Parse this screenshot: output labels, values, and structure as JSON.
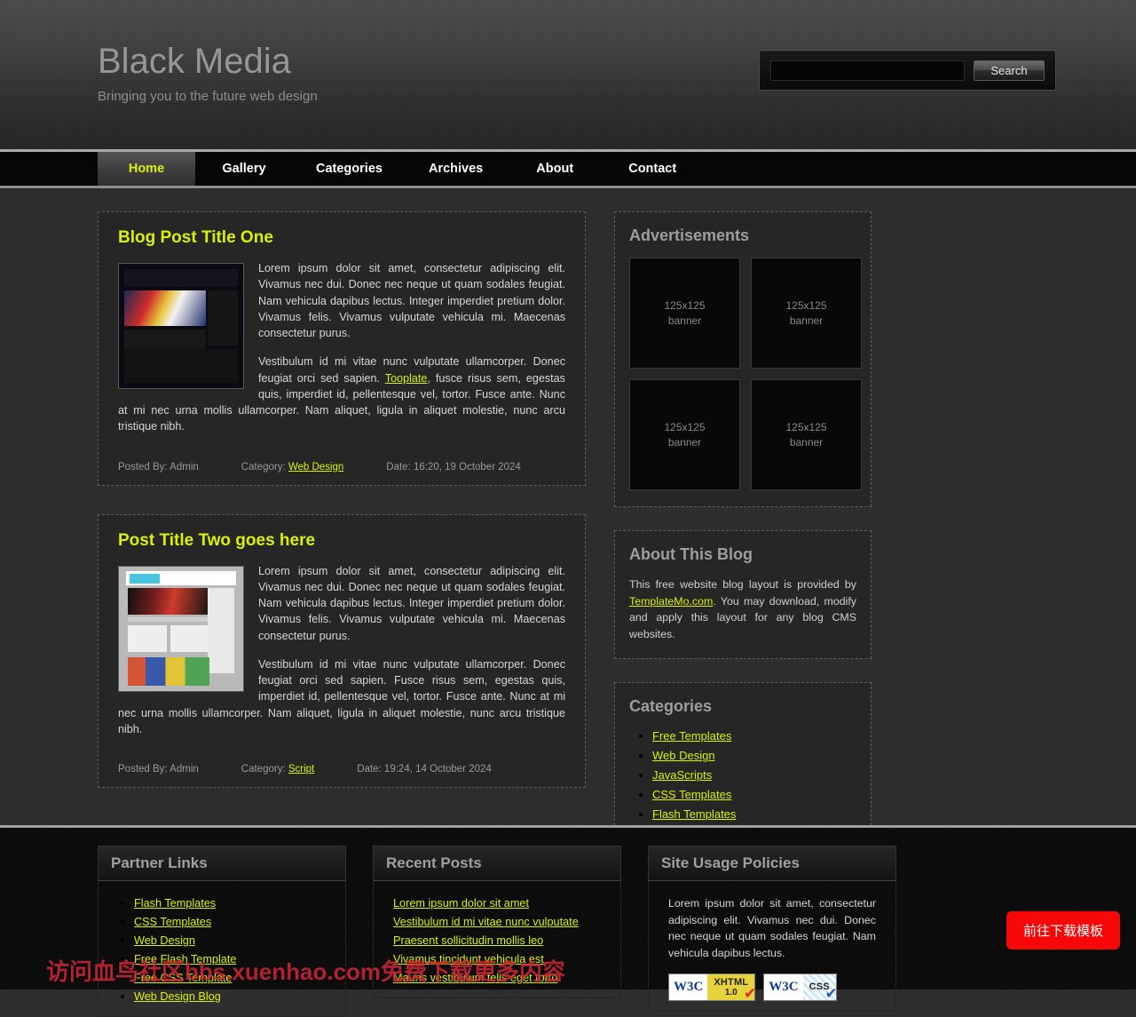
{
  "header": {
    "title": "Black Media",
    "tagline": "Bringing you to the future web design",
    "search": {
      "value": "",
      "placeholder": "",
      "button_label": "Search"
    }
  },
  "nav": {
    "items": [
      {
        "label": "Home",
        "active": true
      },
      {
        "label": "Gallery",
        "active": false
      },
      {
        "label": "Categories",
        "active": false
      },
      {
        "label": "Archives",
        "active": false
      },
      {
        "label": "About",
        "active": false
      },
      {
        "label": "Contact",
        "active": false
      }
    ]
  },
  "posts": [
    {
      "title": "Blog Post Title One",
      "para1": "Lorem ipsum dolor sit amet, consectetur adipiscing elit. Vivamus nec dui. Donec nec neque ut quam sodales feugiat. Nam vehicula dapibus lectus. Integer imperdiet pretium dolor. Vivamus felis. Vivamus vulputate vehicula mi. Maecenas consectetur purus.",
      "para2_before": "Vestibulum id mi vitae nunc vulputate ullamcorper. Donec feugiat orci sed sapien. ",
      "para2_link": "Tooplate",
      "para2_after": ", fusce risus sem, egestas quis, imperdiet id, pellentesque vel, tortor. Fusce ante. Nunc at mi nec urna mollis ullamcorper. Nam aliquet, ligula in aliquet molestie, nunc arcu tristique nibh.",
      "posted_by": "Posted By: Admin",
      "category_label": "Category:",
      "category_link": "Web Design",
      "date": "Date: 16:20, 19 October 2024"
    },
    {
      "title": "Post Title Two goes here",
      "para1": "Lorem ipsum dolor sit amet, consectetur adipiscing elit. Vivamus nec dui. Donec nec neque ut quam sodales feugiat. Nam vehicula dapibus lectus. Integer imperdiet pretium dolor. Vivamus felis. Vivamus vulputate vehicula mi. Maecenas consectetur purus.",
      "para2_before": "Vestibulum id mi vitae nunc vulputate ullamcorper. Donec feugiat orci sed sapien. Fusce risus sem, egestas quis, imperdiet id, pellentesque vel, tortor. Fusce ante. Nunc at mi nec urna mollis ullamcorper. Nam aliquet, ligula in aliquet molestie, nunc arcu tristique nibh.",
      "para2_link": "",
      "para2_after": "",
      "posted_by": "Posted By: Admin",
      "category_label": "Category:",
      "category_link": "Script",
      "date": "Date: 19:24, 14 October 2024"
    }
  ],
  "sidebar": {
    "ads": {
      "title": "Advertisements",
      "banners": [
        {
          "size": "125x125",
          "caption": "banner"
        },
        {
          "size": "125x125",
          "caption": "banner"
        },
        {
          "size": "125x125",
          "caption": "banner"
        },
        {
          "size": "125x125",
          "caption": "banner"
        }
      ]
    },
    "about": {
      "title": "About This Blog",
      "text_before": "This free website blog layout is provided by ",
      "link": "TemplateMo.com",
      "text_after": ". You may download, modify and apply this layout for any blog CMS websites."
    },
    "categories": {
      "title": "Categories",
      "items": [
        "Free Templates",
        "Web Design",
        "JavaScripts",
        "CSS Templates",
        "Flash Templates"
      ]
    }
  },
  "footer": {
    "partner_links": {
      "title": "Partner Links",
      "items": [
        "Flash Templates",
        "CSS Templates",
        "Web Design",
        "Free Flash Template",
        "Free CSS Template",
        "Web Design Blog"
      ]
    },
    "recent_posts": {
      "title": "Recent Posts",
      "items": [
        "Lorem ipsum dolor sit amet",
        "Vestibulum id mi vitae nunc vulputate",
        "Praesent sollicitudin mollis leo",
        "Vivamus tincidunt vehicula est",
        "Mauris vestibulum felis eget torto"
      ]
    },
    "site_usage": {
      "title": "Site Usage Policies",
      "text": "Lorem ipsum dolor sit amet, consectetur adipiscing elit. Vivamus nec dui. Donec nec neque ut quam sodales feugiat. Nam vehicula dapibus lectus.",
      "badges": [
        {
          "org": "W3C",
          "name": "XHTML",
          "version": "1.0"
        },
        {
          "org": "W3C",
          "name": "CSS",
          "version": ""
        }
      ]
    }
  },
  "overlay": {
    "watermark": "访问血鸟社区bbs.xuenhao.com免费下载更多内容",
    "download_button": "前往下载模板"
  },
  "colors": {
    "accent": "#d7f205",
    "overlay_red": "#f60808",
    "watermark_red": "#e12a3c",
    "page_bg": "#2e2e2e"
  }
}
